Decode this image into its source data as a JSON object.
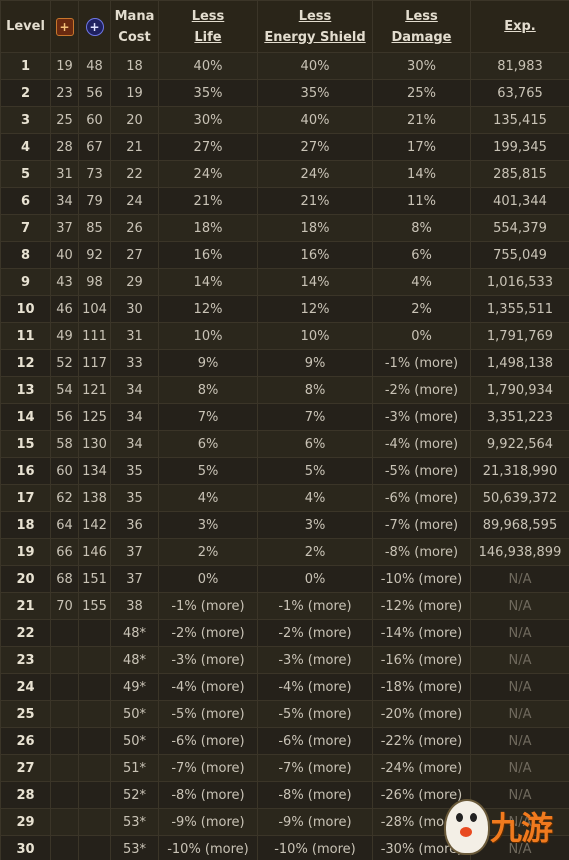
{
  "headers": {
    "level": "Level",
    "str_icon": "strength-icon",
    "int_icon": "intelligence-icon",
    "mana_line1": "Mana",
    "mana_line2": "Cost",
    "life_line1": "Less",
    "life_line2": "Life",
    "es_line1": "Less",
    "es_line2": "Energy Shield",
    "dmg_line1": "Less",
    "dmg_line2": "Damage",
    "exp": "Exp."
  },
  "rows": [
    {
      "level": "1",
      "str": "19",
      "int": "48",
      "mana": "18",
      "life": "40%",
      "es": "40%",
      "dmg": "30%",
      "exp": "81,983"
    },
    {
      "level": "2",
      "str": "23",
      "int": "56",
      "mana": "19",
      "life": "35%",
      "es": "35%",
      "dmg": "25%",
      "exp": "63,765"
    },
    {
      "level": "3",
      "str": "25",
      "int": "60",
      "mana": "20",
      "life": "30%",
      "es": "40%",
      "dmg": "21%",
      "exp": "135,415"
    },
    {
      "level": "4",
      "str": "28",
      "int": "67",
      "mana": "21",
      "life": "27%",
      "es": "27%",
      "dmg": "17%",
      "exp": "199,345"
    },
    {
      "level": "5",
      "str": "31",
      "int": "73",
      "mana": "22",
      "life": "24%",
      "es": "24%",
      "dmg": "14%",
      "exp": "285,815"
    },
    {
      "level": "6",
      "str": "34",
      "int": "79",
      "mana": "24",
      "life": "21%",
      "es": "21%",
      "dmg": "11%",
      "exp": "401,344"
    },
    {
      "level": "7",
      "str": "37",
      "int": "85",
      "mana": "26",
      "life": "18%",
      "es": "18%",
      "dmg": "8%",
      "exp": "554,379"
    },
    {
      "level": "8",
      "str": "40",
      "int": "92",
      "mana": "27",
      "life": "16%",
      "es": "16%",
      "dmg": "6%",
      "exp": "755,049"
    },
    {
      "level": "9",
      "str": "43",
      "int": "98",
      "mana": "29",
      "life": "14%",
      "es": "14%",
      "dmg": "4%",
      "exp": "1,016,533"
    },
    {
      "level": "10",
      "str": "46",
      "int": "104",
      "mana": "30",
      "life": "12%",
      "es": "12%",
      "dmg": "2%",
      "exp": "1,355,511"
    },
    {
      "level": "11",
      "str": "49",
      "int": "111",
      "mana": "31",
      "life": "10%",
      "es": "10%",
      "dmg": "0%",
      "exp": "1,791,769"
    },
    {
      "level": "12",
      "str": "52",
      "int": "117",
      "mana": "33",
      "life": "9%",
      "es": "9%",
      "dmg": "-1% (more)",
      "exp": "1,498,138"
    },
    {
      "level": "13",
      "str": "54",
      "int": "121",
      "mana": "34",
      "life": "8%",
      "es": "8%",
      "dmg": "-2% (more)",
      "exp": "1,790,934"
    },
    {
      "level": "14",
      "str": "56",
      "int": "125",
      "mana": "34",
      "life": "7%",
      "es": "7%",
      "dmg": "-3% (more)",
      "exp": "3,351,223"
    },
    {
      "level": "15",
      "str": "58",
      "int": "130",
      "mana": "34",
      "life": "6%",
      "es": "6%",
      "dmg": "-4% (more)",
      "exp": "9,922,564"
    },
    {
      "level": "16",
      "str": "60",
      "int": "134",
      "mana": "35",
      "life": "5%",
      "es": "5%",
      "dmg": "-5% (more)",
      "exp": "21,318,990"
    },
    {
      "level": "17",
      "str": "62",
      "int": "138",
      "mana": "35",
      "life": "4%",
      "es": "4%",
      "dmg": "-6% (more)",
      "exp": "50,639,372"
    },
    {
      "level": "18",
      "str": "64",
      "int": "142",
      "mana": "36",
      "life": "3%",
      "es": "3%",
      "dmg": "-7% (more)",
      "exp": "89,968,595"
    },
    {
      "level": "19",
      "str": "66",
      "int": "146",
      "mana": "37",
      "life": "2%",
      "es": "2%",
      "dmg": "-8% (more)",
      "exp": "146,938,899"
    },
    {
      "level": "20",
      "str": "68",
      "int": "151",
      "mana": "37",
      "life": "0%",
      "es": "0%",
      "dmg": "-10% (more)",
      "exp": "N/A"
    },
    {
      "level": "21",
      "str": "70",
      "int": "155",
      "mana": "38",
      "life": "-1% (more)",
      "es": "-1% (more)",
      "dmg": "-12% (more)",
      "exp": "N/A"
    },
    {
      "level": "22",
      "str": "",
      "int": "",
      "mana": "48*",
      "life": "-2% (more)",
      "es": "-2% (more)",
      "dmg": "-14% (more)",
      "exp": "N/A"
    },
    {
      "level": "23",
      "str": "",
      "int": "",
      "mana": "48*",
      "life": "-3% (more)",
      "es": "-3% (more)",
      "dmg": "-16% (more)",
      "exp": "N/A"
    },
    {
      "level": "24",
      "str": "",
      "int": "",
      "mana": "49*",
      "life": "-4% (more)",
      "es": "-4% (more)",
      "dmg": "-18% (more)",
      "exp": "N/A"
    },
    {
      "level": "25",
      "str": "",
      "int": "",
      "mana": "50*",
      "life": "-5% (more)",
      "es": "-5% (more)",
      "dmg": "-20% (more)",
      "exp": "N/A"
    },
    {
      "level": "26",
      "str": "",
      "int": "",
      "mana": "50*",
      "life": "-6% (more)",
      "es": "-6% (more)",
      "dmg": "-22% (more)",
      "exp": "N/A"
    },
    {
      "level": "27",
      "str": "",
      "int": "",
      "mana": "51*",
      "life": "-7% (more)",
      "es": "-7% (more)",
      "dmg": "-24% (more)",
      "exp": "N/A"
    },
    {
      "level": "28",
      "str": "",
      "int": "",
      "mana": "52*",
      "life": "-8% (more)",
      "es": "-8% (more)",
      "dmg": "-26% (more)",
      "exp": "N/A"
    },
    {
      "level": "29",
      "str": "",
      "int": "",
      "mana": "53*",
      "life": "-9% (more)",
      "es": "-9% (more)",
      "dmg": "-28% (more)",
      "exp": "N/A"
    },
    {
      "level": "30",
      "str": "",
      "int": "",
      "mana": "53*",
      "life": "-10% (more)",
      "es": "-10% (more)",
      "dmg": "-30% (more)",
      "exp": "N/A"
    }
  ],
  "watermark": {
    "text": "九游",
    "icon": "mascot-logo-icon"
  },
  "colors": {
    "background": "#262219",
    "row_odd": "#2b271c",
    "row_even": "#25211a",
    "text": "#c9c3b6",
    "header_text": "#e3ddcf",
    "na_text": "#6f695d",
    "strength": "#c8762c",
    "intelligence": "#6e76e6",
    "watermark": "#f07a1e"
  }
}
